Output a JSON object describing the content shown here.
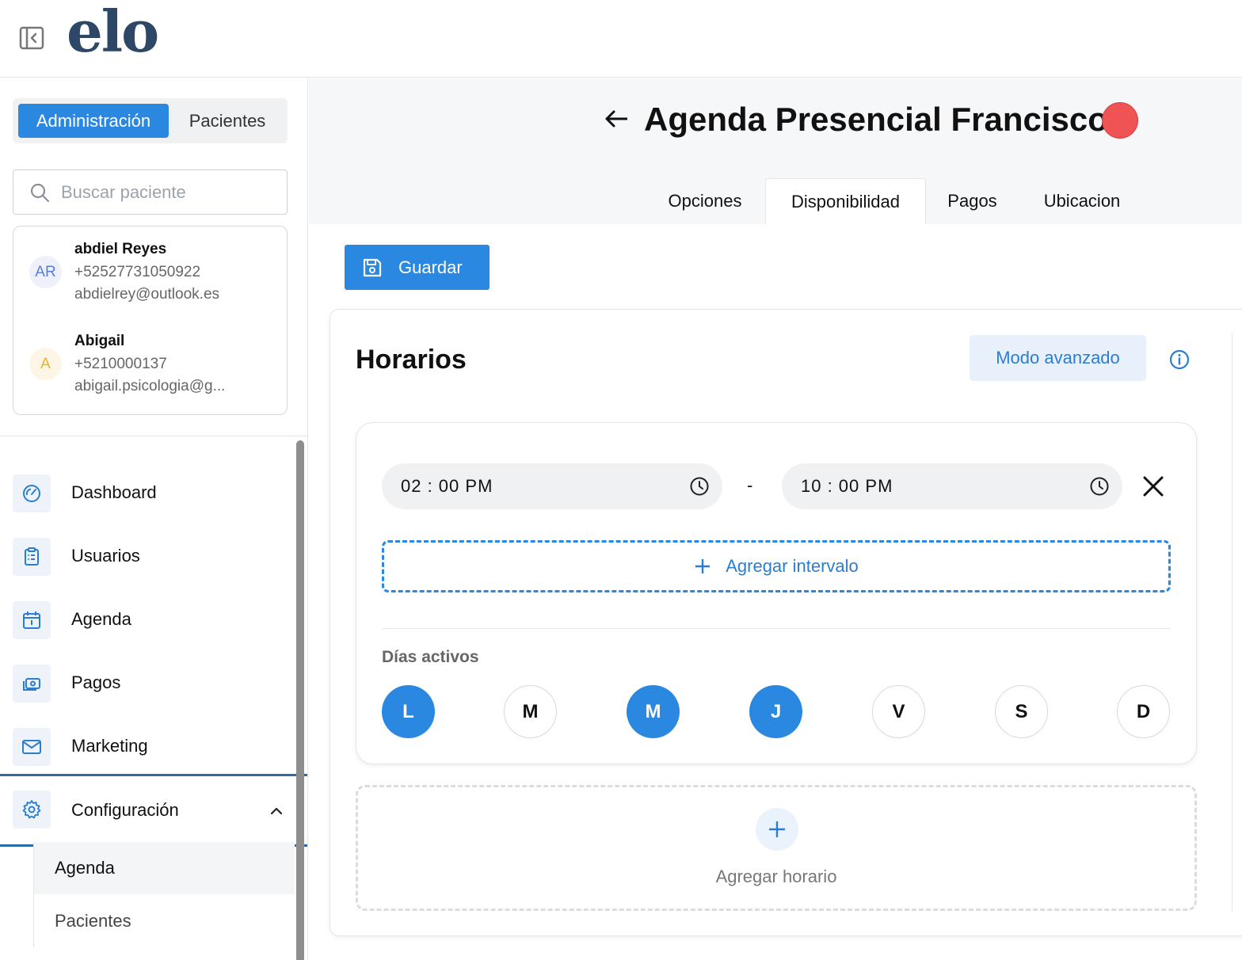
{
  "app": {
    "logo": "elo"
  },
  "sidebar": {
    "segment": {
      "active": "Administración",
      "inactive": "Pacientes"
    },
    "search": {
      "placeholder": "Buscar paciente"
    },
    "patients": [
      {
        "initials": "AR",
        "name": "abdiel Reyes",
        "phone": "+52527731050922",
        "email": "abdielrey@outlook.es"
      },
      {
        "initials": "A",
        "name": "Abigail",
        "phone": "+5210000137",
        "email": "abigail.psicologia@g..."
      }
    ],
    "nav": [
      {
        "label": "Dashboard",
        "icon": "dashboard-icon"
      },
      {
        "label": "Usuarios",
        "icon": "clipboard-icon"
      },
      {
        "label": "Agenda",
        "icon": "calendar-icon"
      },
      {
        "label": "Pagos",
        "icon": "cash-icon"
      },
      {
        "label": "Marketing",
        "icon": "mail-icon"
      },
      {
        "label": "Configuración",
        "icon": "gear-icon"
      }
    ],
    "subnav": [
      {
        "label": "Agenda",
        "active": true
      },
      {
        "label": "Pacientes",
        "active": false
      }
    ]
  },
  "header": {
    "title": "Agenda Presencial Francisco",
    "status_color": "#ef5353",
    "tabs": [
      {
        "label": "Opciones",
        "active": false
      },
      {
        "label": "Disponibilidad",
        "active": true
      },
      {
        "label": "Pagos",
        "active": false
      },
      {
        "label": "Ubicacion",
        "active": false
      }
    ]
  },
  "toolbar": {
    "save_label": "Guardar"
  },
  "schedule": {
    "title": "Horarios",
    "advanced_label": "Modo avanzado",
    "slot": {
      "start": "02 : 00  PM",
      "end": "10 : 00  PM",
      "separator": "-",
      "add_interval_label": "Agregar intervalo",
      "days_label": "Días activos",
      "days": [
        {
          "letter": "L",
          "active": true
        },
        {
          "letter": "M",
          "active": false
        },
        {
          "letter": "M",
          "active": true
        },
        {
          "letter": "J",
          "active": true
        },
        {
          "letter": "V",
          "active": false
        },
        {
          "letter": "S",
          "active": false
        },
        {
          "letter": "D",
          "active": false
        }
      ]
    },
    "add_schedule_label": "Agregar horario"
  },
  "colors": {
    "accent": "#2b88e0",
    "brand": "#2f4766"
  }
}
